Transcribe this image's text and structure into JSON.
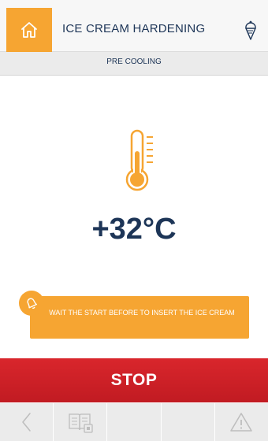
{
  "header": {
    "title": "ICE CREAM HARDENING",
    "home_icon": "home-icon",
    "right_icon": "ice-cream-cone-icon"
  },
  "status": {
    "phase": "PRE COOLING",
    "temperature": "+32°C",
    "icon": "thermometer-icon"
  },
  "message": {
    "text": "WAIT THE START BEFORE TO INSERT THE ICE CREAM",
    "icon": "bell-icon"
  },
  "stop_button": {
    "label": "STOP"
  },
  "bottom_bar": {
    "items": [
      {
        "icon": "back-arrow-icon"
      },
      {
        "icon": "recipe-book-icon"
      },
      {
        "icon": ""
      },
      {
        "icon": ""
      },
      {
        "icon": "warning-icon"
      }
    ]
  },
  "colors": {
    "accent": "#f6a532",
    "text": "#1d3557",
    "stop": "#d9262c"
  }
}
